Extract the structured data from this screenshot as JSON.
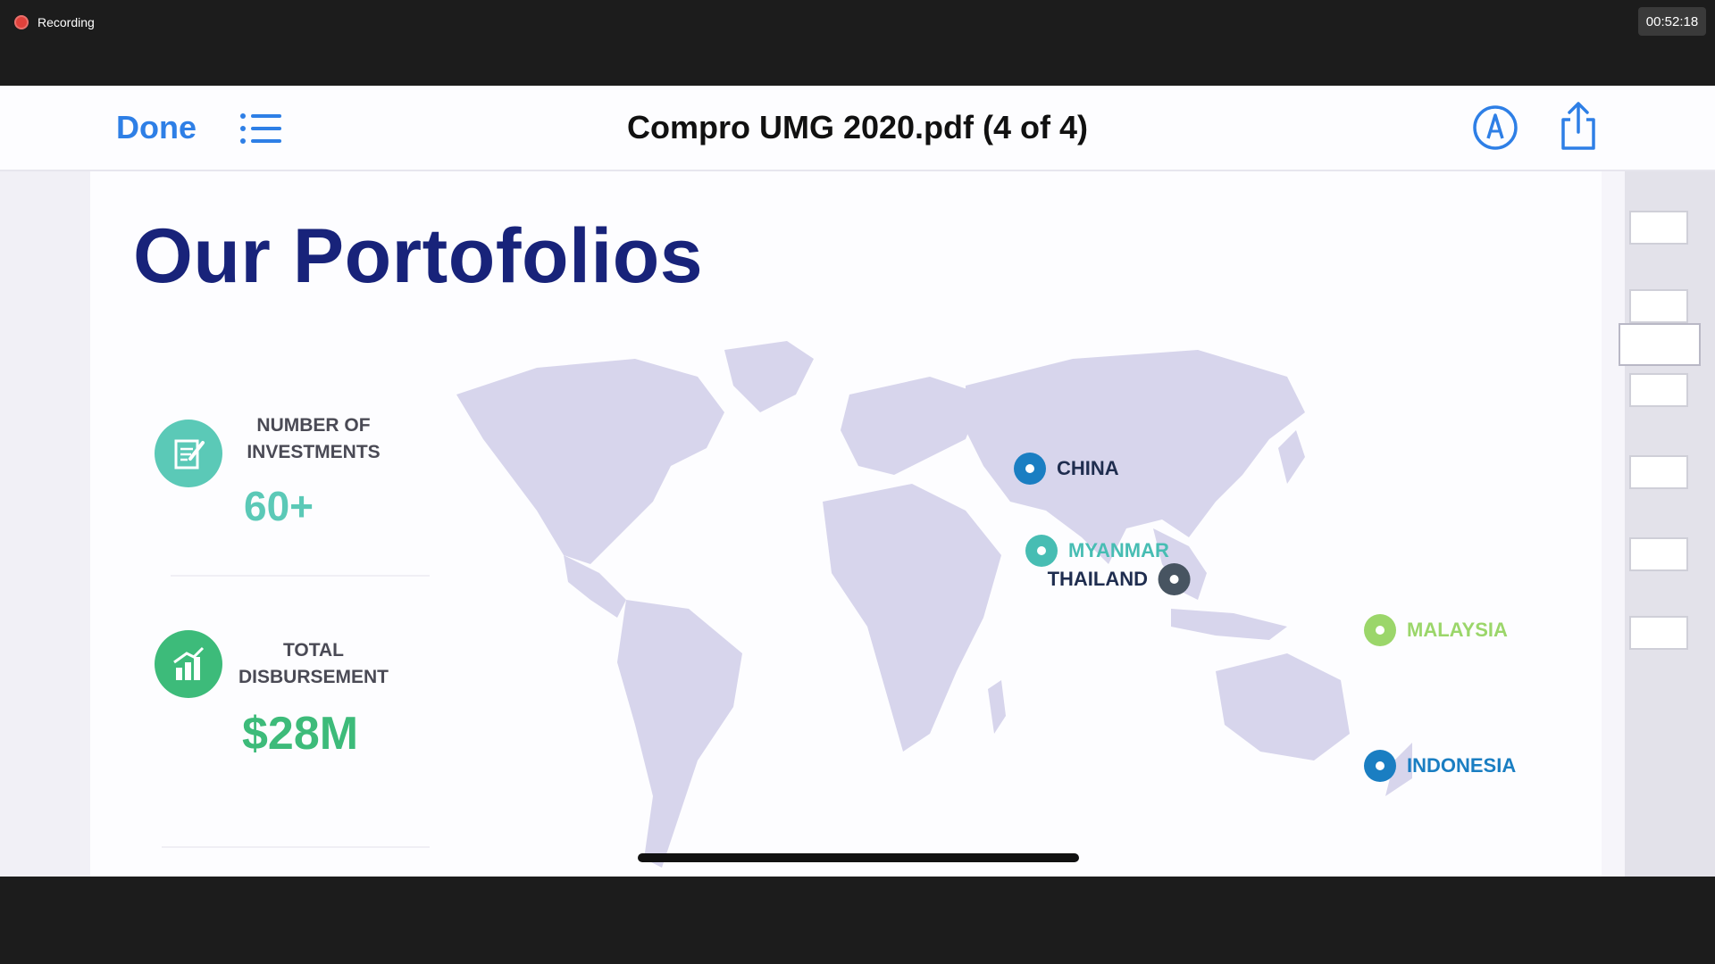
{
  "recording": {
    "label": "Recording",
    "timer": "00:52:18"
  },
  "viewer": {
    "done_label": "Done",
    "list_icon": "list-icon",
    "title": "Compro UMG 2020.pdf (4 of 4)",
    "markup_icon": "markup-pen-icon",
    "share_icon": "share-icon"
  },
  "slide": {
    "title": "Our Portofolios",
    "stats": [
      {
        "label": "NUMBER OF INVESTMENTS",
        "value": "60+",
        "icon": "document-edit-icon",
        "color": "#5bc9b7"
      },
      {
        "label": "TOTAL DISBURSEMENT",
        "value": "$28M",
        "icon": "bar-chart-icon",
        "color": "#3dbb7a"
      }
    ],
    "locations": [
      {
        "name": "CHINA",
        "color": "#1a7ec2",
        "label_color": "#1f2d4f"
      },
      {
        "name": "MYANMAR",
        "color": "#47bdb3",
        "label_color": "#47bdb3"
      },
      {
        "name": "THAILAND",
        "color": "#475461",
        "label_color": "#1f2d4f"
      },
      {
        "name": "MALAYSIA",
        "color": "#9bd66a",
        "label_color": "#9bd66a"
      },
      {
        "name": "INDONESIA",
        "color": "#1a7ec2",
        "label_color": "#1a7ec2"
      }
    ],
    "map_color": "#d7d5ec"
  },
  "thumbnails": {
    "count": 6,
    "active_index": 2
  }
}
